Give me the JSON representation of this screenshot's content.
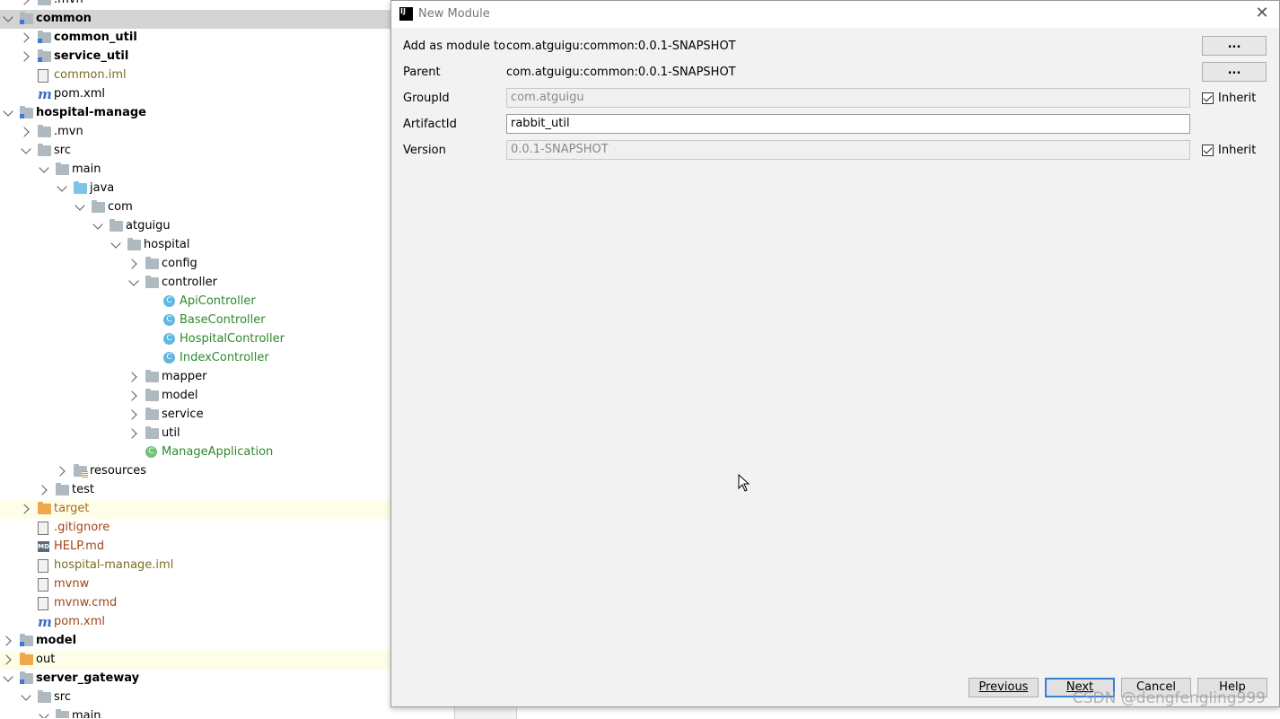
{
  "tree": [
    {
      "label": ".mvn",
      "depth": 1,
      "arrow": "right",
      "icon": "folder",
      "style": ""
    },
    {
      "label": "common",
      "depth": 0,
      "arrow": "down",
      "icon": "module-folder",
      "style": "bold",
      "selected": true
    },
    {
      "label": "common_util",
      "depth": 1,
      "arrow": "right",
      "icon": "module-folder",
      "style": "bold"
    },
    {
      "label": "service_util",
      "depth": 1,
      "arrow": "right",
      "icon": "module-folder",
      "style": "bold"
    },
    {
      "label": "common.iml",
      "depth": 1,
      "arrow": "",
      "icon": "iml-file",
      "style": "olive"
    },
    {
      "label": "pom.xml",
      "depth": 1,
      "arrow": "",
      "icon": "maven-icon",
      "style": ""
    },
    {
      "label": "hospital-manage",
      "depth": 0,
      "arrow": "down",
      "icon": "module-folder",
      "style": "bold"
    },
    {
      "label": ".mvn",
      "depth": 1,
      "arrow": "right",
      "icon": "folder",
      "style": ""
    },
    {
      "label": "src",
      "depth": 1,
      "arrow": "down",
      "icon": "folder",
      "style": ""
    },
    {
      "label": "main",
      "depth": 2,
      "arrow": "down",
      "icon": "folder",
      "style": ""
    },
    {
      "label": "java",
      "depth": 3,
      "arrow": "down",
      "icon": "source-folder",
      "style": ""
    },
    {
      "label": "com",
      "depth": 4,
      "arrow": "down",
      "icon": "package",
      "style": ""
    },
    {
      "label": "atguigu",
      "depth": 5,
      "arrow": "down",
      "icon": "package",
      "style": ""
    },
    {
      "label": "hospital",
      "depth": 6,
      "arrow": "down",
      "icon": "package",
      "style": ""
    },
    {
      "label": "config",
      "depth": 7,
      "arrow": "right",
      "icon": "package",
      "style": ""
    },
    {
      "label": "controller",
      "depth": 7,
      "arrow": "down",
      "icon": "package",
      "style": ""
    },
    {
      "label": "ApiController",
      "depth": 8,
      "arrow": "",
      "icon": "class-icon",
      "style": "green"
    },
    {
      "label": "BaseController",
      "depth": 8,
      "arrow": "",
      "icon": "class-icon",
      "style": "green"
    },
    {
      "label": "HospitalController",
      "depth": 8,
      "arrow": "",
      "icon": "class-icon",
      "style": "green"
    },
    {
      "label": "IndexController",
      "depth": 8,
      "arrow": "",
      "icon": "class-icon",
      "style": "green"
    },
    {
      "label": "mapper",
      "depth": 7,
      "arrow": "right",
      "icon": "package",
      "style": ""
    },
    {
      "label": "model",
      "depth": 7,
      "arrow": "right",
      "icon": "package",
      "style": ""
    },
    {
      "label": "service",
      "depth": 7,
      "arrow": "right",
      "icon": "package",
      "style": ""
    },
    {
      "label": "util",
      "depth": 7,
      "arrow": "right",
      "icon": "package",
      "style": ""
    },
    {
      "label": "ManageApplication",
      "depth": 7,
      "arrow": "",
      "icon": "spring-class-icon",
      "style": "green"
    },
    {
      "label": "resources",
      "depth": 3,
      "arrow": "right",
      "icon": "resources-folder",
      "style": ""
    },
    {
      "label": "test",
      "depth": 2,
      "arrow": "right",
      "icon": "folder",
      "style": ""
    },
    {
      "label": "target",
      "depth": 1,
      "arrow": "right",
      "icon": "excluded-folder",
      "style": "browntg",
      "highlight": true
    },
    {
      "label": ".gitignore",
      "depth": 1,
      "arrow": "",
      "icon": "text-file",
      "style": "brown"
    },
    {
      "label": "HELP.md",
      "depth": 1,
      "arrow": "",
      "icon": "markdown-icon",
      "style": "brown"
    },
    {
      "label": "hospital-manage.iml",
      "depth": 1,
      "arrow": "",
      "icon": "iml-file",
      "style": "olive"
    },
    {
      "label": "mvnw",
      "depth": 1,
      "arrow": "",
      "icon": "text-file",
      "style": "brown"
    },
    {
      "label": "mvnw.cmd",
      "depth": 1,
      "arrow": "",
      "icon": "text-file",
      "style": "brown"
    },
    {
      "label": "pom.xml",
      "depth": 1,
      "arrow": "",
      "icon": "maven-icon",
      "style": "brown"
    },
    {
      "label": "model",
      "depth": 0,
      "arrow": "right",
      "icon": "module-folder",
      "style": "bold"
    },
    {
      "label": "out",
      "depth": 0,
      "arrow": "right",
      "icon": "excluded-folder",
      "style": "",
      "highlight": true
    },
    {
      "label": "server_gateway",
      "depth": 0,
      "arrow": "down",
      "icon": "module-folder",
      "style": "bold"
    },
    {
      "label": "src",
      "depth": 1,
      "arrow": "down",
      "icon": "folder",
      "style": ""
    },
    {
      "label": "main",
      "depth": 2,
      "arrow": "down",
      "icon": "folder",
      "style": ""
    }
  ],
  "dialog": {
    "title": "New Module",
    "app_icon_text": "IJ",
    "fields": {
      "add_as_module_label": "Add as module to",
      "add_as_module_value": "com.atguigu:common:0.0.1-SNAPSHOT",
      "parent_label": "Parent",
      "parent_value": "com.atguigu:common:0.0.1-SNAPSHOT",
      "groupid_label": "GroupId",
      "groupid_value": "com.atguigu",
      "artifactid_label": "ArtifactId",
      "artifactid_value": "rabbit_util",
      "version_label": "Version",
      "version_value": "0.0.1-SNAPSHOT"
    },
    "browse_label": "...",
    "inherit_label": "Inherit",
    "groupid_inherit_checked": true,
    "version_inherit_checked": true,
    "buttons": {
      "previous": "Previous",
      "next": "Next",
      "cancel": "Cancel",
      "help": "Help"
    }
  },
  "watermark": "CSDN @dengfengling999"
}
